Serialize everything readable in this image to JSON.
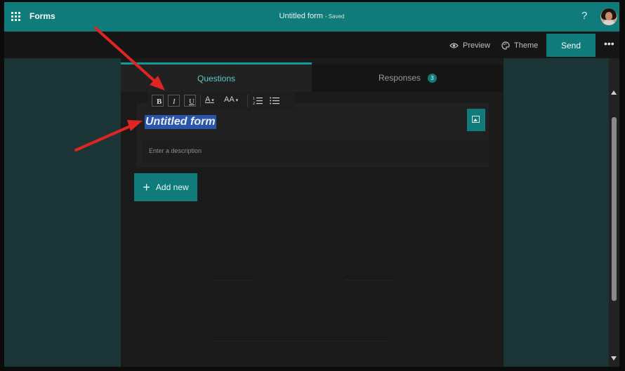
{
  "topbar": {
    "app_name": "Forms",
    "doc_title": "Untitled form",
    "save_status": "- Saved",
    "help_label": "?"
  },
  "toolbar": {
    "preview_label": "Preview",
    "theme_label": "Theme",
    "send_label": "Send",
    "more_label": "•••"
  },
  "tabs": {
    "questions_label": "Questions",
    "responses_label": "Responses",
    "responses_count": "3"
  },
  "format_toolbar": {
    "bold": "B",
    "italic": "I",
    "underline": "U",
    "font_color": "A",
    "font_size": "AA"
  },
  "form": {
    "title": "Untitled form",
    "description_placeholder": "Enter a description"
  },
  "actions": {
    "add_new_label": "Add new"
  },
  "colors": {
    "accent": "#0f7b7a",
    "selection": "#2a55a8",
    "arrow": "#e02424"
  }
}
